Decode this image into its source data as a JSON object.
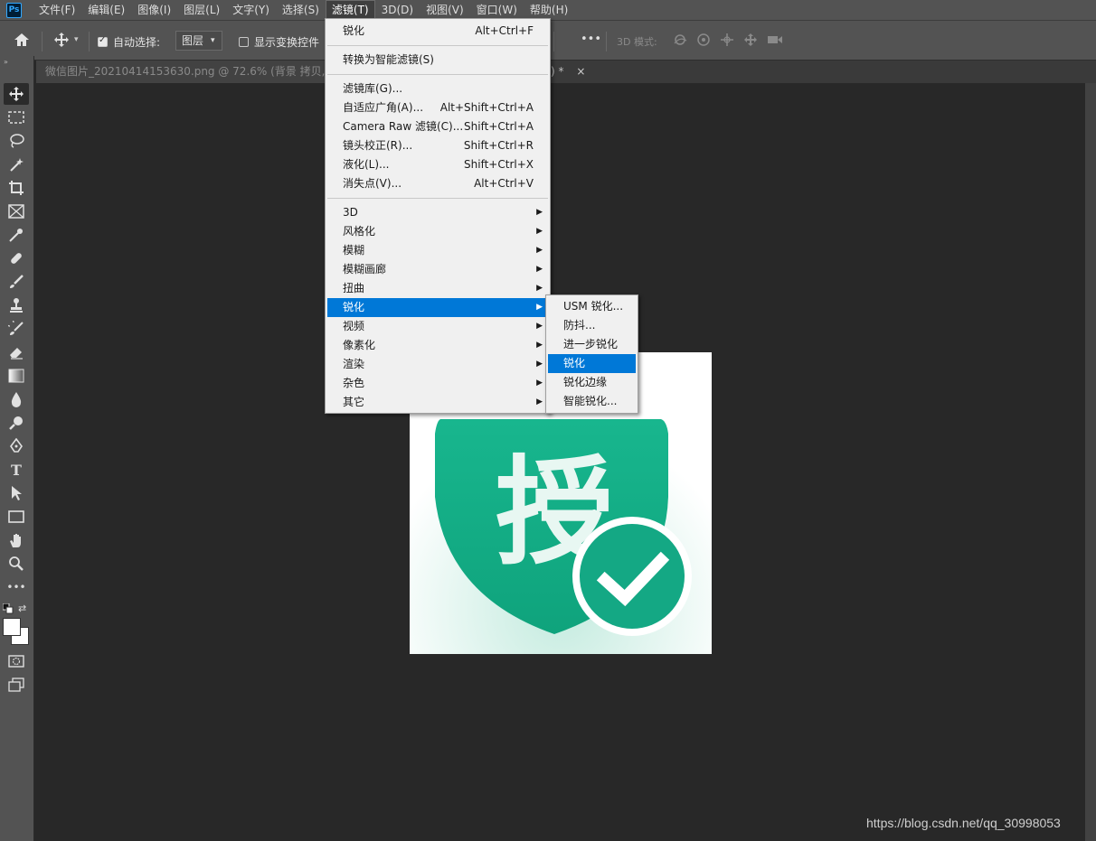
{
  "app": {
    "logo": "Ps"
  },
  "menubar": {
    "items": [
      "文件(F)",
      "编辑(E)",
      "图像(I)",
      "图层(L)",
      "文字(Y)",
      "选择(S)",
      "滤镜(T)",
      "3D(D)",
      "视图(V)",
      "窗口(W)",
      "帮助(H)"
    ],
    "active_index": 6
  },
  "options": {
    "auto_select_label": "自动选择:",
    "auto_select_checked": true,
    "layer_select_value": "图层",
    "show_transform_label": "显示变换控件",
    "show_transform_checked": false,
    "more_label": "•••",
    "mode_3d_label": "3D 模式:"
  },
  "tabs": [
    {
      "title": "微信图片_20210414153630.png @ 72.6% (背景 拷贝, RG",
      "active": false
    },
    {
      "title": ") *",
      "active": false
    }
  ],
  "tab_close_label": "×",
  "filter_menu": {
    "items": [
      {
        "label": "锐化",
        "shortcut": "Alt+Ctrl+F"
      },
      {
        "separator": true
      },
      {
        "label": "转换为智能滤镜(S)"
      },
      {
        "separator": true
      },
      {
        "label": "滤镜库(G)..."
      },
      {
        "label": "自适应广角(A)...",
        "shortcut": "Alt+Shift+Ctrl+A"
      },
      {
        "label": "Camera Raw 滤镜(C)...",
        "shortcut": "Shift+Ctrl+A"
      },
      {
        "label": "镜头校正(R)...",
        "shortcut": "Shift+Ctrl+R"
      },
      {
        "label": "液化(L)...",
        "shortcut": "Shift+Ctrl+X"
      },
      {
        "label": "消失点(V)...",
        "shortcut": "Alt+Ctrl+V"
      },
      {
        "separator": true
      },
      {
        "label": "3D",
        "submenu": true
      },
      {
        "label": "风格化",
        "submenu": true
      },
      {
        "label": "模糊",
        "submenu": true
      },
      {
        "label": "模糊画廊",
        "submenu": true
      },
      {
        "label": "扭曲",
        "submenu": true
      },
      {
        "label": "锐化",
        "submenu": true,
        "highlight": true
      },
      {
        "label": "视频",
        "submenu": true
      },
      {
        "label": "像素化",
        "submenu": true
      },
      {
        "label": "渲染",
        "submenu": true
      },
      {
        "label": "杂色",
        "submenu": true
      },
      {
        "label": "其它",
        "submenu": true
      }
    ]
  },
  "sharpen_submenu": {
    "items": [
      {
        "label": "USM 锐化..."
      },
      {
        "label": "防抖..."
      },
      {
        "label": "进一步锐化"
      },
      {
        "label": "锐化",
        "highlight": true
      },
      {
        "label": "锐化边缘"
      },
      {
        "label": "智能锐化..."
      }
    ]
  },
  "document": {
    "icon_character": "授",
    "colors": {
      "shield": "#16b28a",
      "shield_dark": "#0e9e78",
      "check_circle": "#14a884",
      "glow": "#d8f1ea"
    }
  },
  "toolbar": {
    "tools": [
      "move-tool",
      "marquee-tool",
      "lasso-tool",
      "magic-wand-tool",
      "crop-tool",
      "frame-tool",
      "eyedropper-tool",
      "healing-brush-tool",
      "brush-tool",
      "clone-stamp-tool",
      "history-brush-tool",
      "eraser-tool",
      "gradient-tool",
      "blur-tool",
      "dodge-tool",
      "pen-tool",
      "type-tool",
      "path-selection-tool",
      "rectangle-tool",
      "hand-tool",
      "zoom-tool",
      "more-tools"
    ],
    "type_tool_glyph": "T",
    "more_glyph": "•••"
  },
  "watermark": "https://blog.csdn.net/qq_30998053"
}
